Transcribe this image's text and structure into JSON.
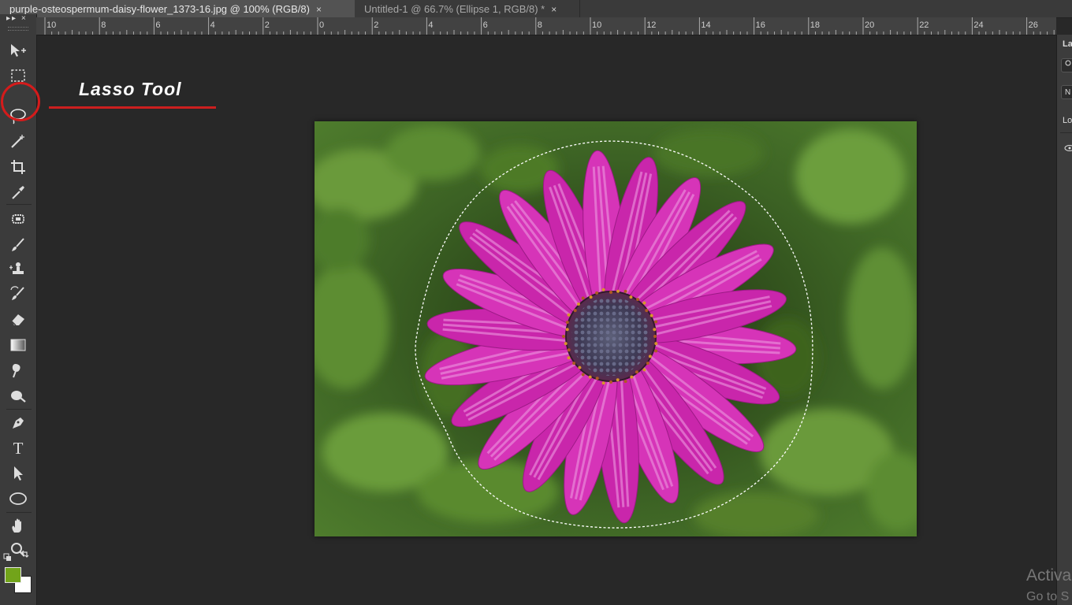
{
  "tabs": [
    {
      "label": "purple-osteospermum-daisy-flower_1373-16.jpg @ 100% (RGB/8)",
      "close": "×",
      "active": true
    },
    {
      "label": "Untitled-1 @ 66.7% (Ellipse 1, RGB/8) *",
      "close": "×",
      "active": false
    }
  ],
  "toolbar": {
    "header_glyphs": "▸▸ ×",
    "tools": [
      {
        "name": "move-tool",
        "icon": "move-icon"
      },
      {
        "name": "rectangular-marquee-tool",
        "icon": "marquee-icon"
      },
      {
        "name": "lasso-tool",
        "icon": "lasso-icon"
      },
      {
        "name": "quick-selection-tool",
        "icon": "magic-wand-icon"
      },
      {
        "name": "crop-tool",
        "icon": "crop-icon"
      },
      {
        "name": "eyedropper-tool",
        "icon": "eyedropper-icon"
      },
      {
        "name": "spot-healing-tool",
        "icon": "healing-icon"
      },
      {
        "name": "brush-tool",
        "icon": "brush-icon"
      },
      {
        "name": "clone-stamp-tool",
        "icon": "stamp-icon"
      },
      {
        "name": "history-brush-tool",
        "icon": "history-brush-icon"
      },
      {
        "name": "eraser-tool",
        "icon": "eraser-icon"
      },
      {
        "name": "gradient-tool",
        "icon": "gradient-icon"
      },
      {
        "name": "blur-tool",
        "icon": "blur-icon"
      },
      {
        "name": "dodge-tool",
        "icon": "dodge-icon"
      },
      {
        "name": "pen-tool",
        "icon": "pen-icon"
      },
      {
        "name": "type-tool",
        "icon": "type-icon",
        "glyph": "T"
      },
      {
        "name": "path-selection-tool",
        "icon": "arrow-icon"
      },
      {
        "name": "ellipse-tool",
        "icon": "ellipse-icon"
      },
      {
        "name": "hand-tool",
        "icon": "hand-icon"
      },
      {
        "name": "zoom-tool",
        "icon": "zoom-icon"
      }
    ],
    "foreground_color": "#72a41a",
    "background_color": "#ffffff"
  },
  "ruler": {
    "labels": [
      "10",
      "8",
      "6",
      "4",
      "2",
      "0",
      "2",
      "4",
      "6",
      "8",
      "10",
      "12",
      "14",
      "16",
      "18",
      "20",
      "22",
      "24",
      "26"
    ]
  },
  "annotation": {
    "label": "Lasso  Tool",
    "color": "#cc1f1f"
  },
  "document": {
    "subject": "purple osteospermum daisy flower",
    "petal_color": "#d531b8",
    "background_color": "#4f7a2c"
  },
  "right_panel": {
    "panel_tab": "La",
    "lock_label": "Lo"
  },
  "watermark": {
    "title": "Activa",
    "subtitle": "Go to S"
  }
}
